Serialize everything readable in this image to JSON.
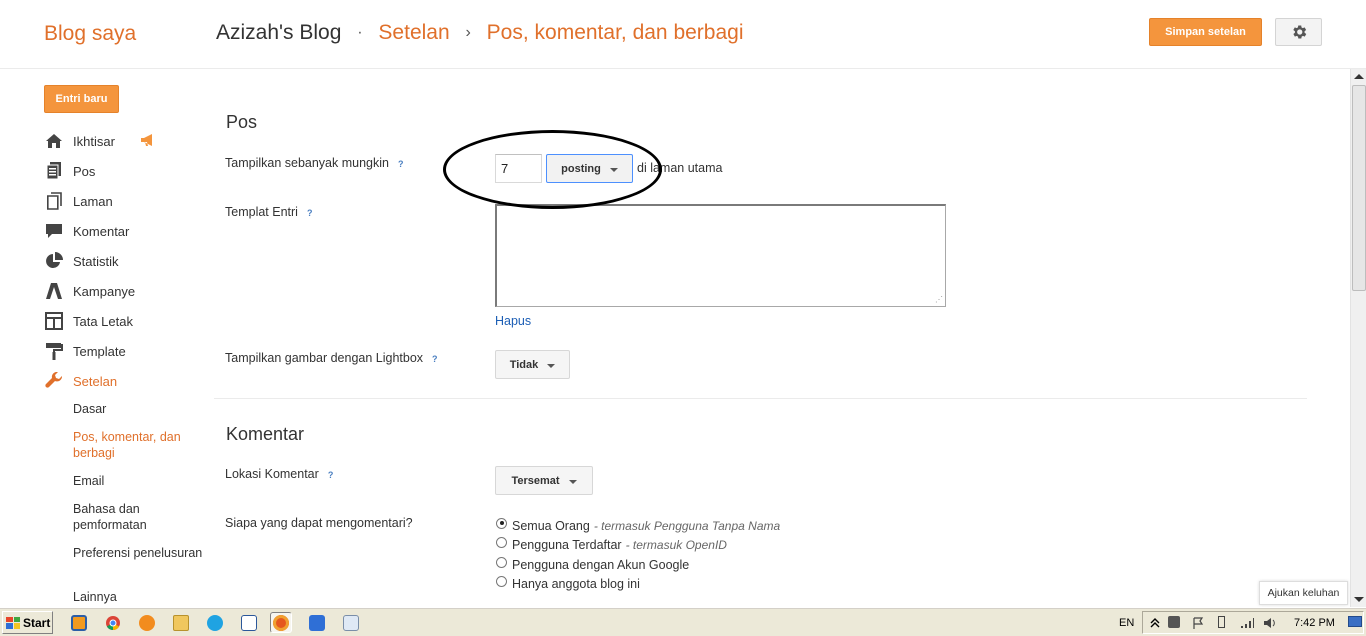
{
  "header": {
    "brand": "Blog saya",
    "blog_name": "Azizah's Blog",
    "dot": "·",
    "crumb_settings": "Setelan",
    "crumb_arrow": "›",
    "crumb_page": "Pos, komentar, dan berbagi",
    "save_label": "Simpan setelan",
    "gear_icon": "gear-icon"
  },
  "sidebar": {
    "new_post_label": "Entri baru",
    "items": [
      {
        "label": "Ikhtisar",
        "icon": "home-icon"
      },
      {
        "label": "Pos",
        "icon": "posts-icon"
      },
      {
        "label": "Laman",
        "icon": "pages-icon"
      },
      {
        "label": "Komentar",
        "icon": "comment-icon"
      },
      {
        "label": "Statistik",
        "icon": "stats-icon"
      },
      {
        "label": "Kampanye",
        "icon": "campaign-icon"
      },
      {
        "label": "Tata Letak",
        "icon": "layout-icon"
      },
      {
        "label": "Template",
        "icon": "template-icon"
      },
      {
        "label": "Setelan",
        "icon": "wrench-icon"
      }
    ],
    "subitems": [
      "Dasar",
      "Pos, komentar, dan berbagi",
      "Email",
      "Bahasa dan pemformatan",
      "Preferensi penelusuran",
      "Lainnya"
    ],
    "accent": "#e0702b"
  },
  "posts": {
    "title": "Pos",
    "show_label": "Tampilkan sebanyak mungkin",
    "help": "?",
    "count_value": "7",
    "unit_value": "posting",
    "after_text": "di laman utama",
    "template_label": "Templat Entri",
    "delete_link": "Hapus",
    "lightbox_label": "Tampilkan gambar dengan Lightbox",
    "lightbox_value": "Tidak"
  },
  "comments": {
    "title": "Komentar",
    "location_label": "Lokasi Komentar",
    "location_value": "Tersemat",
    "who_label": "Siapa yang dapat mengomentari?",
    "options": [
      {
        "label": "Semua Orang",
        "hint": "- termasuk Pengguna Tanpa Nama",
        "selected": true
      },
      {
        "label": "Pengguna Terdaftar",
        "hint": "- termasuk OpenID",
        "selected": false
      },
      {
        "label": "Pengguna dengan Akun Google",
        "hint": "",
        "selected": false
      },
      {
        "label": "Hanya anggota blog ini",
        "hint": "",
        "selected": false
      }
    ]
  },
  "feedback_label": "Ajukan keluhan",
  "taskbar": {
    "start_label": "Start",
    "language": "EN",
    "time": "7:42 PM"
  }
}
